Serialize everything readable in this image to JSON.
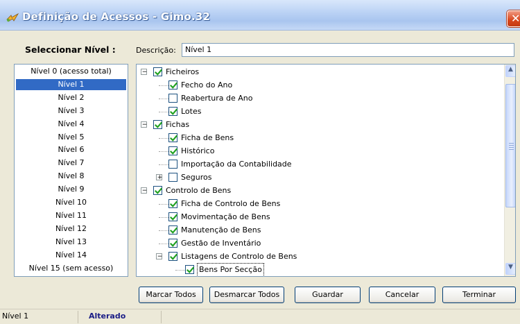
{
  "window": {
    "title": "Definição de Acessos - Gimo.32",
    "close_symbol": "✕"
  },
  "header": {
    "level_heading": "Seleccionar Nível :",
    "description_label": "Descrição:",
    "description_value": "Nível 1"
  },
  "levels": {
    "items": [
      "Nível 0 (acesso total)",
      "Nível 1",
      "Nível 2",
      "Nível 3",
      "Nível 4",
      "Nível 5",
      "Nível 6",
      "Nível 7",
      "Nível 8",
      "Nível 9",
      "Nível 10",
      "Nível 11",
      "Nível 12",
      "Nível 13",
      "Nível 14",
      "Nível 15 (sem acesso)"
    ],
    "selected_index": 1
  },
  "tree": {
    "nodes": [
      {
        "label": "Ficheiros",
        "checked": true,
        "depth": 0,
        "expander": "minus"
      },
      {
        "label": "Fecho do Ano",
        "checked": true,
        "depth": 1
      },
      {
        "label": "Reabertura de Ano",
        "checked": false,
        "depth": 1
      },
      {
        "label": "Lotes",
        "checked": true,
        "depth": 1
      },
      {
        "label": "Fichas",
        "checked": true,
        "depth": 0,
        "expander": "minus"
      },
      {
        "label": "Ficha de Bens",
        "checked": true,
        "depth": 1
      },
      {
        "label": "Histórico",
        "checked": true,
        "depth": 1
      },
      {
        "label": "Importação da Contabilidade",
        "checked": false,
        "depth": 1
      },
      {
        "label": "Seguros",
        "checked": false,
        "depth": 1,
        "expander": "plus"
      },
      {
        "label": "Controlo de Bens",
        "checked": true,
        "depth": 0,
        "expander": "minus"
      },
      {
        "label": "Ficha de Controlo de Bens",
        "checked": true,
        "depth": 1
      },
      {
        "label": "Movimentação de Bens",
        "checked": true,
        "depth": 1
      },
      {
        "label": "Manutenção de Bens",
        "checked": true,
        "depth": 1
      },
      {
        "label": "Gestão de Inventário",
        "checked": true,
        "depth": 1
      },
      {
        "label": "Listagens de Controlo de Bens",
        "checked": true,
        "depth": 1,
        "expander": "minus"
      },
      {
        "label": "Bens Por Secção",
        "checked": true,
        "depth": 2,
        "focused": true
      }
    ]
  },
  "buttons": {
    "mark_all": "Marcar Todos",
    "unmark_all": "Desmarcar Todos",
    "save": "Guardar",
    "cancel": "Cancelar",
    "finish": "Terminar"
  },
  "status": {
    "level": "Nível 1",
    "state": "Alterado"
  },
  "colors": {
    "selection": "#316ac5",
    "status_state": "#1b1d86",
    "check": "#21a121"
  }
}
